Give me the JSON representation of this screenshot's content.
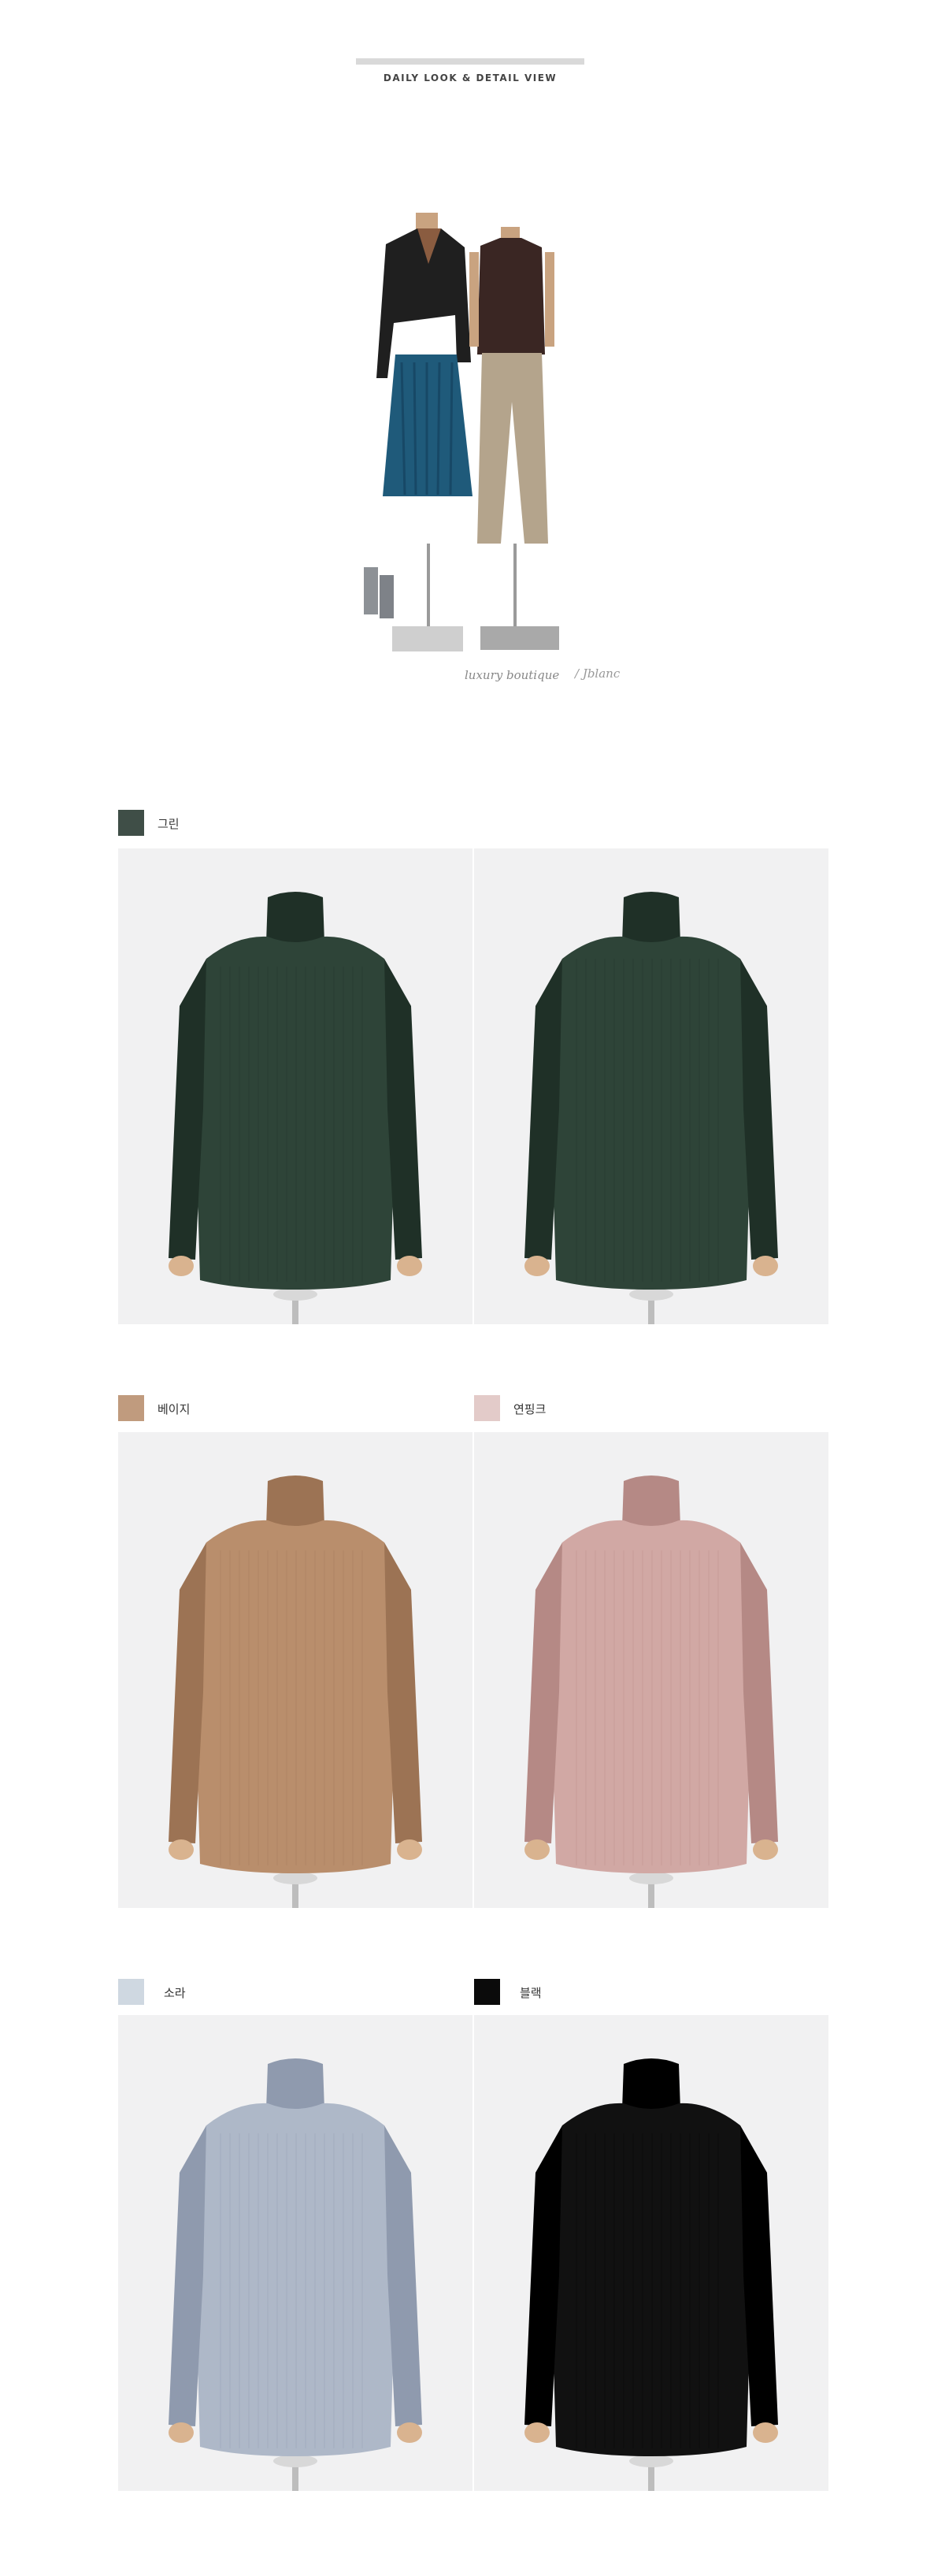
{
  "header": {
    "title": "DAILY LOOK & DETAIL VIEW"
  },
  "brand": {
    "text": "luxury boutique",
    "signature": "/ Jblanc"
  },
  "colors": [
    {
      "label": "그린",
      "hex": "#3f4e47",
      "garment": "#2e4438",
      "garment_dark": "#1f3027"
    },
    {
      "label": "베이지",
      "hex": "#c09b7e",
      "garment": "#b98e6c",
      "garment_dark": "#9c7354"
    },
    {
      "label": "연핑크",
      "hex": "#e3cbc9",
      "garment": "#d1a8a4",
      "garment_dark": "#b58985"
    },
    {
      "label": "소라",
      "hex": "#cfd8e1",
      "garment": "#aeb8c8",
      "garment_dark": "#8f9aae"
    },
    {
      "label": "블랙",
      "hex": "#0b0b0b",
      "garment": "#111111",
      "garment_dark": "#000000"
    }
  ]
}
